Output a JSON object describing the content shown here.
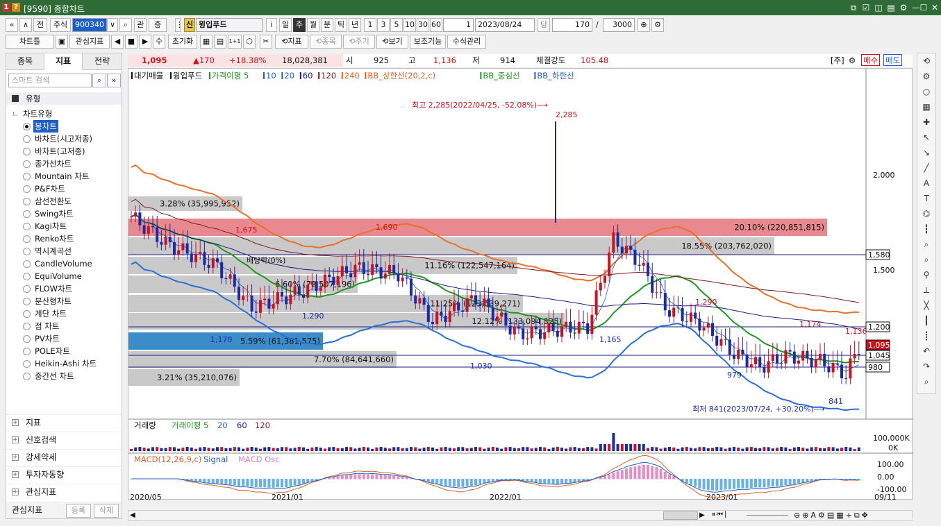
{
  "window": {
    "title": "[9590] 종합차트",
    "app_icon_1": "1",
    "app_icon_2": "?"
  },
  "toolbar1": {
    "nav_first": "«",
    "nav_up": "∧",
    "prev_label": "전",
    "market": "주식",
    "code": "900340",
    "dd": "∨",
    "search_icon": "⌕",
    "related": "관",
    "company_btn": "증",
    "dots": "⋮",
    "shin": "신",
    "stock_name": "윙입푸드",
    "info": "i",
    "periods": [
      "일",
      "주",
      "월",
      "분",
      "틱",
      "년"
    ],
    "selected_period": "주",
    "nums": [
      "1",
      "3",
      "5",
      "10",
      "30",
      "60"
    ],
    "unit": "1",
    "date": "2023/08/24",
    "dang": "당",
    "count": "170",
    "slash": "/",
    "total": "3000"
  },
  "toolbar2": {
    "chart_tab": "차트틀",
    "icon1": "▣",
    "indicator": "관심지표",
    "arrows": [
      "◀",
      "■",
      "▶"
    ],
    "su": "수",
    "reset": "초기화",
    "grid1": "▦",
    "grid2": "▤",
    "b1": "1+1",
    "b2": "⬡",
    "b3": "✂",
    "jipyo": "⟲지표",
    "jongmok": "⟲종목",
    "jugi": "⟲주기",
    "bogi": "⟲보기",
    "assist": "보조기능",
    "formula": "수식관리"
  },
  "left": {
    "tabs": [
      "종목",
      "지표",
      "전략"
    ],
    "selected_tab": "지표",
    "search_placeholder": "스마트 검색",
    "group": "유형",
    "sub": "차트유형",
    "items": [
      "봉차트",
      "바차트(시고저종)",
      "바차트(고저종)",
      "종가선차트",
      "Mountain 차트",
      "P&F차트",
      "삼선전환도",
      "Swing차트",
      "Kagi차트",
      "Renko차트",
      "역시계곡선",
      "CandleVolume",
      "EquiVolume",
      "FLOW차트",
      "분산형차트",
      "계단 차트",
      "점 차트",
      "PV차트",
      "POLE차트",
      "Heikin-Ashi 차트",
      "중간선 차트"
    ],
    "selected": "봉차트",
    "sections": [
      "지표",
      "신호검색",
      "강세약세",
      "투자자동향",
      "관심지표"
    ],
    "footer_label": "관심지표",
    "register": "등록",
    "delete": "삭제"
  },
  "info": {
    "price": "1,095",
    "change": "▲170",
    "pct": "+18.38%",
    "volume": "18,028,381",
    "open_l": "시",
    "open": "925",
    "high_l": "고",
    "high": "1,136",
    "low_l": "저",
    "low": "914",
    "strength_l": "체결강도",
    "strength": "105.48",
    "unit": "[주]",
    "buy": "매수",
    "sell": "매도"
  },
  "legend": {
    "items": [
      {
        "t": "대기매물",
        "c": "#111"
      },
      {
        "t": "윙입푸드",
        "c": "#111"
      },
      {
        "t": "가격이평 5",
        "c": "#1a9a1a"
      },
      {
        "t": "10",
        "c": "#1e5ec8"
      },
      {
        "t": "20",
        "c": "#1e5ec8"
      },
      {
        "t": "60",
        "c": "#1a1a80"
      },
      {
        "t": "120",
        "c": "#7a1a1a"
      },
      {
        "t": "240",
        "c": "#e06020"
      },
      {
        "t": "BB_상한선(20,2,c)",
        "c": "#e06020"
      },
      {
        "t": "BB_중심선",
        "c": "#1a9a1a"
      },
      {
        "t": "BB_하한선",
        "c": "#1e5ec8"
      }
    ]
  },
  "annot": {
    "high": "최고 2,285(2022/04/25, -52.08%)⟶",
    "high_val": "2,285",
    "low": "최저 841(2023/07/24, +30.20%)⟶",
    "low_val": "841",
    "l1675": "1,675",
    "l1690": "1,690",
    "l1290a": "1,290",
    "l1170": "1,170",
    "l1030": "1,030",
    "l1165": "1,165",
    "l1290b": "1,290",
    "l1174": "1,174",
    "l1136": "1,136",
    "l979": "979",
    "div": "배당락(0%)"
  },
  "bands": [
    {
      "label": "3.28% (35,995,952)",
      "hl": false
    },
    {
      "label": "20.10% (220,851,815)",
      "hl": "red"
    },
    {
      "label": "18.55% (203,762,020)",
      "hl": false
    },
    {
      "label": "11.16% (122,547,164)",
      "hl": false
    },
    {
      "label": "6.60% (72,507,196)",
      "hl": false
    },
    {
      "label": "11.25% (123,539,271)",
      "hl": false
    },
    {
      "label": "12.12% (133,094,325)",
      "hl": false
    },
    {
      "label": "5.59% (61,381,575)",
      "hl": "blue"
    },
    {
      "label": "7.70% (84,641,660)",
      "hl": false
    },
    {
      "label": "3.21% (35,210,076)",
      "hl": false
    }
  ],
  "axis": {
    "y": [
      "2,000",
      "1,500"
    ],
    "y_tags": [
      "1,580",
      "1,200",
      "1,095",
      "1,045",
      "980"
    ],
    "x": [
      "2020/05",
      "2021/01",
      "2022/01",
      "2023/01",
      "09/11"
    ]
  },
  "volume": {
    "label": "거래량",
    "ma": "거래이평 5",
    "p20": "20",
    "p60": "60",
    "p120": "120",
    "yl": [
      "100,000K",
      "0K"
    ]
  },
  "macd": {
    "label": "MACD(12,26,9,c)",
    "signal": "Signal",
    "osc": "MACD Osc",
    "yl": [
      "100.00",
      "0.00",
      "-100.00"
    ]
  },
  "chart_data": {
    "type": "candlestick",
    "series": [
      {
        "name": "윙입푸드",
        "last_close": 1095,
        "high": 2285,
        "high_date": "2022/04/25",
        "low": 841,
        "low_date": "2023/07/24"
      }
    ],
    "ylim": [
      800,
      2300
    ],
    "x": [
      "2020/05",
      "2021/01",
      "2022/01",
      "2023/01",
      "09/11"
    ]
  }
}
